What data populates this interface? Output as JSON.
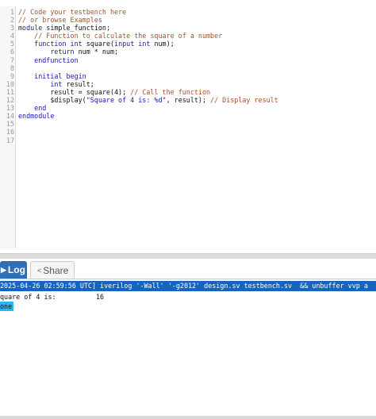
{
  "editor": {
    "lines": [
      {
        "num": "1",
        "parts": [
          {
            "t": "// Code your testbench here",
            "c": "cmt"
          }
        ]
      },
      {
        "num": "2",
        "parts": [
          {
            "t": "// or browse Examples",
            "c": "cmt"
          }
        ]
      },
      {
        "num": "3",
        "parts": [
          {
            "t": "module",
            "c": "kw"
          },
          {
            "t": " simple_function;",
            "c": ""
          }
        ]
      },
      {
        "num": "4",
        "parts": [
          {
            "t": "    // Function to calculate the square of a number",
            "c": "cmt"
          }
        ]
      },
      {
        "num": "5",
        "parts": [
          {
            "t": "    function int",
            "c": "kw"
          },
          {
            "t": " square(",
            "c": ""
          },
          {
            "t": "input int",
            "c": "kw"
          },
          {
            "t": " num);",
            "c": ""
          }
        ]
      },
      {
        "num": "6",
        "parts": [
          {
            "t": "        return",
            "c": "kw"
          },
          {
            "t": " num * num;",
            "c": ""
          }
        ]
      },
      {
        "num": "7",
        "parts": [
          {
            "t": "    endfunction",
            "c": "kw"
          }
        ]
      },
      {
        "num": "8",
        "parts": []
      },
      {
        "num": "9",
        "parts": [
          {
            "t": "    initial begin",
            "c": "kw"
          }
        ]
      },
      {
        "num": "10",
        "parts": [
          {
            "t": "        int",
            "c": "kw"
          },
          {
            "t": " result;",
            "c": ""
          }
        ]
      },
      {
        "num": "11",
        "parts": [
          {
            "t": "        result = square(4); ",
            "c": ""
          },
          {
            "t": "// Call the function",
            "c": "cmt"
          }
        ]
      },
      {
        "num": "12",
        "parts": [
          {
            "t": "        $display(",
            "c": ""
          },
          {
            "t": "\"Square of 4 is: %d\"",
            "c": "str"
          },
          {
            "t": ", result); ",
            "c": ""
          },
          {
            "t": "// Display result",
            "c": "cmt"
          }
        ]
      },
      {
        "num": "13",
        "parts": [
          {
            "t": "    end",
            "c": "kw"
          }
        ]
      },
      {
        "num": "14",
        "parts": [
          {
            "t": "endmodule",
            "c": "kw"
          }
        ]
      },
      {
        "num": "15",
        "parts": []
      },
      {
        "num": "16",
        "parts": []
      },
      {
        "num": "17",
        "parts": []
      }
    ]
  },
  "tabs": {
    "log_label": "Log",
    "share_label": "Share",
    "log_icon": "play-icon",
    "share_icon": "share-icon"
  },
  "log": {
    "command": "2025-04-26 02:59:56 UTC] iverilog '-Wall' '-g2012' design.sv testbench.sv  && unbuffer vvp a",
    "output": "quare of 4 is:          16",
    "done": "one"
  },
  "colors": {
    "log_tab": "#2f6fb5",
    "command_bg": "#1565c0",
    "done_bg": "#29b6f6"
  }
}
